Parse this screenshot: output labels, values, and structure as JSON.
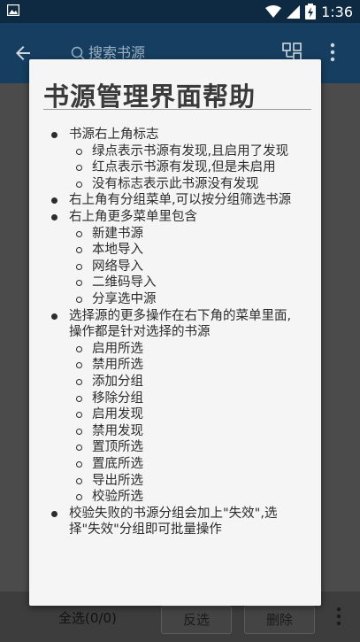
{
  "statusbar": {
    "time": "1:36"
  },
  "toolbar": {
    "search_placeholder": "搜索书源"
  },
  "bottombar": {
    "select_all": "全选(0/0)",
    "invert": "反选",
    "delete": "删除"
  },
  "dialog": {
    "title": "书源管理界面帮助",
    "items": [
      {
        "text": "书源右上角标志",
        "level": 1
      },
      {
        "text": "绿点表示书源有发现,且启用了发现",
        "level": 2
      },
      {
        "text": "红点表示书源有发现,但是未启用",
        "level": 2
      },
      {
        "text": "没有标志表示此书源没有发现",
        "level": 2
      },
      {
        "text": "右上角有分组菜单,可以按分组筛选书源",
        "level": 1
      },
      {
        "text": "右上角更多菜单里包含",
        "level": 1
      },
      {
        "text": "新建书源",
        "level": 2
      },
      {
        "text": "本地导入",
        "level": 2
      },
      {
        "text": "网络导入",
        "level": 2
      },
      {
        "text": "二维码导入",
        "level": 2
      },
      {
        "text": "分享选中源",
        "level": 2
      },
      {
        "text": "选择源的更多操作在右下角的菜单里面,",
        "level": 1
      },
      {
        "text": "操作都是针对选择的书源",
        "level": 0
      },
      {
        "text": "启用所选",
        "level": 2
      },
      {
        "text": "禁用所选",
        "level": 2
      },
      {
        "text": "添加分组",
        "level": 2
      },
      {
        "text": "移除分组",
        "level": 2
      },
      {
        "text": "启用发现",
        "level": 2
      },
      {
        "text": "禁用发现",
        "level": 2
      },
      {
        "text": "置顶所选",
        "level": 2
      },
      {
        "text": "置底所选",
        "level": 2
      },
      {
        "text": "导出所选",
        "level": 2
      },
      {
        "text": "校验所选",
        "level": 2
      },
      {
        "text": "校验失败的书源分组会加上\"失效\",选",
        "level": 1
      },
      {
        "text": "择\"失效\"分组即可批量操作",
        "level": 0
      }
    ]
  },
  "colors": {
    "primary": "#163e60",
    "status_bar": "#0d2a42"
  }
}
